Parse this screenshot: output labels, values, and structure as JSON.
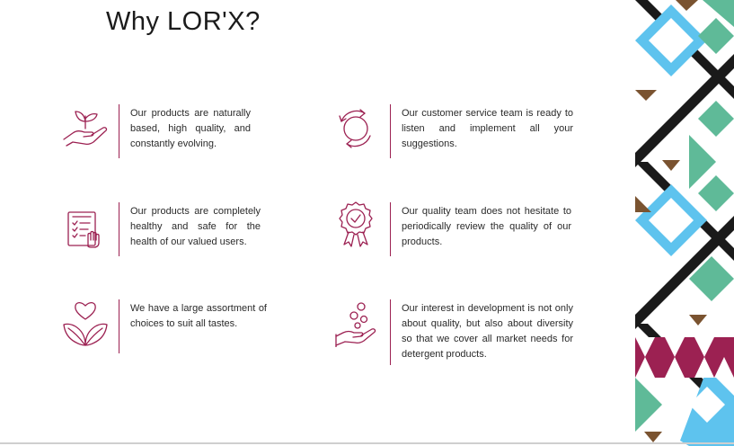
{
  "title": "Why  LOR'X?",
  "features": [
    {
      "icon": "plant-in-hand-icon",
      "text": "Our products are naturally based, high quality, and constantly evolving."
    },
    {
      "icon": "refresh-cycle-icon",
      "text": "Our customer service team is ready to listen and implement all your suggestions."
    },
    {
      "icon": "checklist-icon",
      "text": "Our products are completely healthy and safe for the health of our valued users."
    },
    {
      "icon": "quality-badge-icon",
      "text": "Our quality team does not hesitate to periodically review the quality of our products."
    },
    {
      "icon": "heart-leaves-icon",
      "text": "We have a large assortment of choices to suit all tastes."
    },
    {
      "icon": "hand-bubbles-icon",
      "text": "Our interest in development is not only about quality, but also about diversity so that we cover all market needs for detergent products."
    }
  ],
  "colors": {
    "accent": "#9c2152",
    "pattern_blue": "#5ec3ee",
    "pattern_green": "#5fba98",
    "pattern_brown": "#7a5330",
    "pattern_black": "#1a1a1a",
    "pattern_magenta": "#9c2152"
  }
}
